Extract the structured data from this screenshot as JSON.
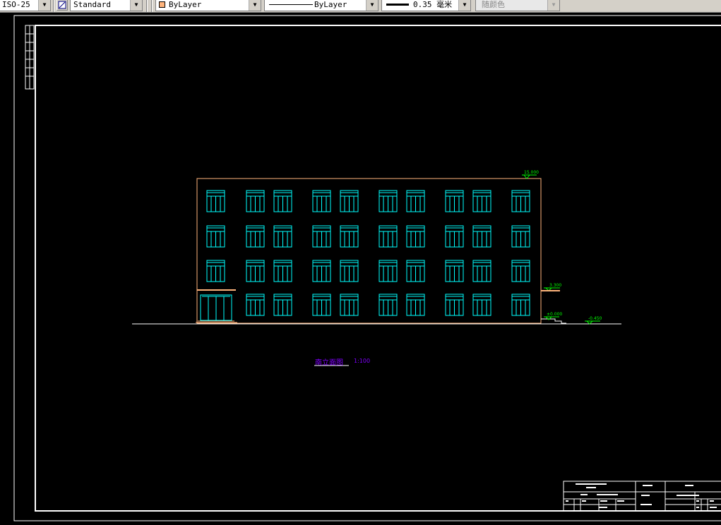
{
  "toolbar": {
    "dimstyle": "ISO-25",
    "textstyle": "Standard",
    "layer": "ByLayer",
    "linetype": "ByLayer",
    "lineweight": "0.35 毫米",
    "plotstyle": "随颜色"
  },
  "drawing": {
    "title": "南立面图",
    "scale": "1:100",
    "elevations": {
      "roof": "15.000",
      "first_floor": "3.300",
      "ground": "±0.000",
      "outdoor": "-0.450"
    }
  },
  "colors": {
    "background": "#000000",
    "building_outline": "#ffb47c",
    "windows": "#00ffff",
    "elevation_marks": "#00ff00",
    "title_text": "#8000ff",
    "frame": "#ffffff"
  }
}
